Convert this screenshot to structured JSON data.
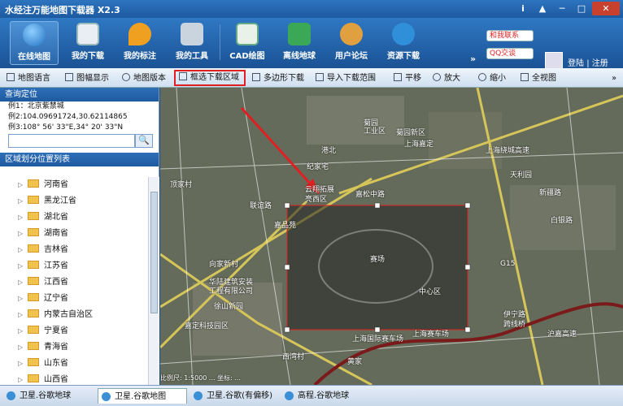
{
  "app": {
    "title": "水经注万能地图下载器 X2.3"
  },
  "window": {
    "buttons": [
      "i",
      "▲",
      "─",
      "□",
      "✕"
    ]
  },
  "toolbar": {
    "items": [
      {
        "label": "在线地图",
        "icon": "globe-icon",
        "color": "#3a8ad6"
      },
      {
        "label": "我的下载",
        "icon": "download-list-icon",
        "color": "#e9eef5"
      },
      {
        "label": "我的标注",
        "icon": "map-pin-icon",
        "color": "#f0a020"
      },
      {
        "label": "我的工具",
        "icon": "tools-icon",
        "color": "#c9d4df"
      },
      {
        "label": "CAD绘图",
        "icon": "cad-icon",
        "color": "#e9f2e9"
      },
      {
        "label": "离线地球",
        "icon": "cubes-icon",
        "color": "#3aa857"
      },
      {
        "label": "用户论坛",
        "icon": "users-icon",
        "color": "#e0a040"
      },
      {
        "label": "资源下载",
        "icon": "resource-icon",
        "color": "#2f8fd8"
      }
    ],
    "more": "»",
    "promo": [
      "和我联系",
      "QQ交谈"
    ],
    "login": "登陆",
    "sep": "|",
    "register": "注册"
  },
  "subbar": {
    "items": [
      "地图语言",
      "图幅显示",
      "地图版本",
      "框选下载区域",
      "多边形下载",
      "导入下载范围",
      "平移",
      "放大",
      "缩小",
      "全视图"
    ],
    "more": "»"
  },
  "panel": {
    "query_title": "查询定位",
    "examples": [
      "例1：北京紫禁城",
      "例2:104.09691724,30.62114865",
      "例3:108° 56' 33\"E,34° 20' 33\"N"
    ],
    "search_placeholder": "",
    "search_icon": "🔍",
    "region_title": "区域划分位置列表",
    "provinces": [
      "河南省",
      "黑龙江省",
      "湖北省",
      "湖南省",
      "吉林省",
      "江苏省",
      "江西省",
      "辽宁省",
      "内蒙古自治区",
      "宁夏省",
      "青海省",
      "山东省",
      "山西省"
    ]
  },
  "map": {
    "labels": [
      "菊园",
      "上海嘉定",
      "菊园新区",
      "港北",
      "工业区",
      "顶家村",
      "云翔拓展",
      "亮西区",
      "联谊路",
      "嘉品苑",
      "华陆建筑安装",
      "工程有限公司",
      "徐山新园",
      "嘉定科技园区",
      "西湾村",
      "黄家",
      "上海赛车场",
      "上海国际赛车场",
      "伊宁路",
      "跨线桥",
      "白银路",
      "新疆路",
      "上海绕城高速",
      "嘉松中路",
      "G15",
      "赛场",
      "中心区",
      "天利园",
      "沪嘉高速",
      "向家新村",
      "纪家宅"
    ],
    "status": "比例尺: 1:5000  ...  坐标: ..."
  },
  "statusbar": {
    "tabs": [
      "卫星.谷歌地球",
      "卫星.谷歌地图",
      "卫星.谷歌(有偏移)",
      "高程.谷歌地球"
    ]
  }
}
